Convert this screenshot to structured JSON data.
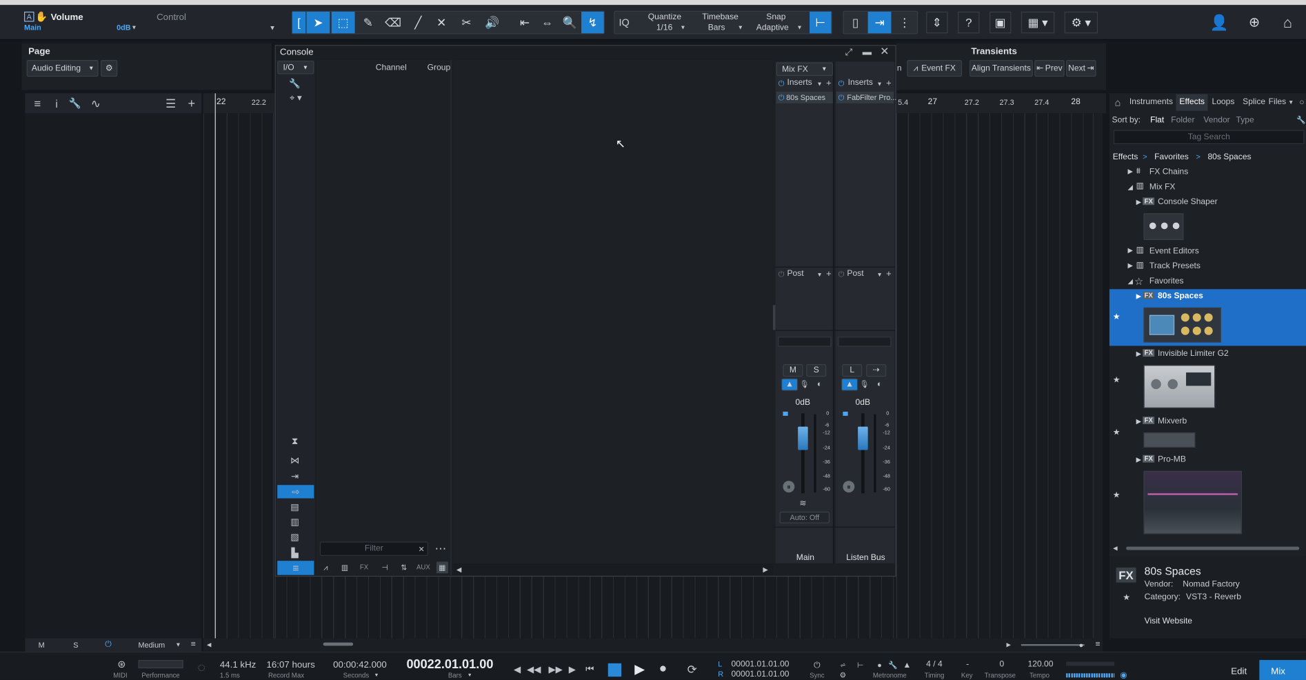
{
  "colors": {
    "accent": "#1f7fd0",
    "bg": "#14171b",
    "panel": "#1d2126",
    "selected_row": "#1f6fc8"
  },
  "header": {
    "track_name": "Volume",
    "track_sub": "Main",
    "track_value": "0dB",
    "control_label": "Control",
    "quantize_label": "Quantize",
    "quantize_value": "1/16",
    "timebase_label": "Timebase",
    "timebase_value": "Bars",
    "snap_label": "Snap",
    "snap_value": "Adaptive",
    "iq_label": "IQ"
  },
  "left_panel": {
    "page_label": "Page",
    "page_value": "Audio Editing"
  },
  "timeline": {
    "left_ticks": [
      "22",
      "22.2"
    ],
    "right_ticks": [
      "5.4",
      "27",
      "27.2",
      "27.3",
      "27.4",
      "28"
    ]
  },
  "transients": {
    "title": "Transients",
    "event_fx": "Event FX",
    "align": "Align Transients",
    "prev": "Prev",
    "next": "Next",
    "partial_n": "n"
  },
  "console": {
    "title": "Console",
    "io_label": "I/O",
    "channel_header": "Channel",
    "group_header": "Group",
    "filter_placeholder": "Filter",
    "bottom_tabs": [
      "FX",
      "AUX"
    ],
    "mix_fx": "Mix FX",
    "strips": [
      {
        "inserts": "Inserts",
        "insert_slot": "80s Spaces",
        "post": "Post",
        "m": "M",
        "s": "S",
        "level": "0dB",
        "auto": "Auto: Off",
        "name": "Main"
      },
      {
        "inserts": "Inserts",
        "insert_slot": "FabFilter Pro...",
        "post": "Post",
        "m": "L",
        "level": "0dB",
        "name": "Listen Bus"
      }
    ],
    "meter_scale": [
      "0",
      "-6",
      "-12",
      "-24",
      "-36",
      "-48",
      "-60"
    ]
  },
  "browser": {
    "tabs": [
      "Instruments",
      "Effects",
      "Loops",
      "Splice",
      "Files"
    ],
    "active_tab": "Effects",
    "sort_label": "Sort by:",
    "sort_options": [
      "Flat",
      "Folder",
      "Vendor",
      "Type"
    ],
    "active_sort": "Flat",
    "search_placeholder": "Tag Search",
    "breadcrumb": [
      "Effects",
      "Favorites",
      "80s Spaces"
    ],
    "items": {
      "fx_chains": "FX Chains",
      "mix_fx": "Mix FX",
      "console_shaper": "Console Shaper",
      "event_editors": "Event Editors",
      "track_presets": "Track Presets",
      "favorites": "Favorites",
      "spaces": "80s Spaces",
      "limiter": "Invisible Limiter G2",
      "mixverb": "Mixverb",
      "promb": "Pro-MB"
    },
    "fx_tag": "FX",
    "info": {
      "name": "80s Spaces",
      "vendor_label": "Vendor:",
      "vendor": "Nomad Factory",
      "category_label": "Category:",
      "category": "VST3 - Reverb",
      "website": "Visit Website"
    }
  },
  "track_footer": {
    "m": "M",
    "s": "S",
    "size": "Medium"
  },
  "transport": {
    "midi": "MIDI",
    "performance": "Performance",
    "sample_rate": "44.1 kHz",
    "latency": "1.5 ms",
    "record_time": "16:07 hours",
    "record_max": "Record Max",
    "time_secs": "00:00:42.000",
    "seconds": "Seconds",
    "position": "00022.01.01.00",
    "bars": "Bars",
    "loop_l": "00001.01.01.00",
    "loop_r": "00001.01.01.00",
    "l": "L",
    "r": "R",
    "sync": "Sync",
    "metronome": "Metronome",
    "timing_value": "4 / 4",
    "timing": "Timing",
    "key_value": "-",
    "key": "Key",
    "transpose_value": "0",
    "transpose": "Transpose",
    "tempo_value": "120.00",
    "tempo": "Tempo",
    "edit": "Edit",
    "mix": "Mix"
  }
}
